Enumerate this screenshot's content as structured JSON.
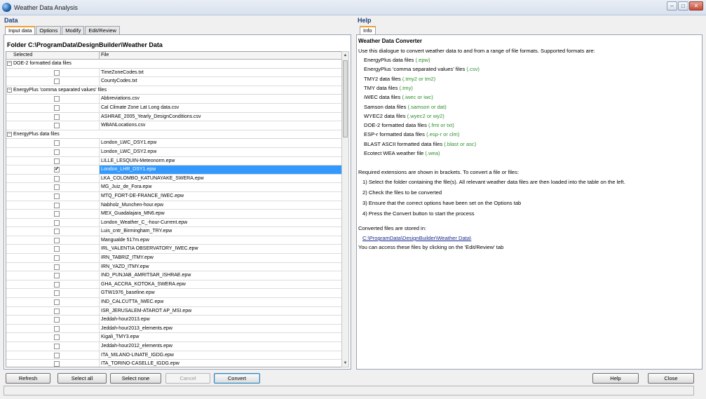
{
  "window": {
    "title": "Weather Data Analysis"
  },
  "data_panel": {
    "header": "Data",
    "tabs": [
      "Input data",
      "Options",
      "Modify",
      "Edit/Review"
    ],
    "folder_label": "Folder  C:\\ProgramData\\DesignBuilder\\Weather Data",
    "columns": {
      "selected": "Selected",
      "file": "File"
    },
    "groups": [
      {
        "name": "DOE-2 formatted data files",
        "rows": [
          {
            "file": "TimeZoneCodes.txt",
            "checked": false
          },
          {
            "file": "CountyCodes.txt",
            "checked": false
          }
        ]
      },
      {
        "name": "EnergyPlus 'comma separated values' files",
        "rows": [
          {
            "file": "Abbreviations.csv",
            "checked": false
          },
          {
            "file": "Cal Climate Zone Lat Long data.csv",
            "checked": false
          },
          {
            "file": "ASHRAE_2005_Yearly_DesignConditions.csv",
            "checked": false
          },
          {
            "file": "WBANLocations.csv",
            "checked": false
          }
        ]
      },
      {
        "name": "EnergyPlus data files",
        "rows": [
          {
            "file": "London_LWC_DSY1.epw",
            "checked": false
          },
          {
            "file": "London_LWC_DSY2.epw",
            "checked": false
          },
          {
            "file": "LILLE_LESQUIN-Meteonorm.epw",
            "checked": false
          },
          {
            "file": "London_LHR_DSY1.epw",
            "checked": true,
            "selected": true
          },
          {
            "file": "LKA_COLOMBO_KATUNAYAKE_SWERA.epw",
            "checked": false
          },
          {
            "file": "MG_Juiz_de_Fora.epw",
            "checked": false
          },
          {
            "file": "MTQ_FORT-DE-FRANCE_IWEC.epw",
            "checked": false
          },
          {
            "file": "Nabholz_Munchen-hour.epw",
            "checked": false
          },
          {
            "file": "MEX_Guadalajara_MN6.epw",
            "checked": false
          },
          {
            "file": "London_Weather_C_-hour-Current.epw",
            "checked": false
          },
          {
            "file": "Luis_cntr_Birmingham_TRY.epw",
            "checked": false
          },
          {
            "file": "Mangualde 517m.epw",
            "checked": false
          },
          {
            "file": "IRL_VALENTIA OBSERVATORY_IWEC.epw",
            "checked": false
          },
          {
            "file": "IRN_TABRIZ_ITMY.epw",
            "checked": false
          },
          {
            "file": "IRN_YAZD_ITMY.epw",
            "checked": false
          },
          {
            "file": "IND_PUNJAB_AMRITSAR_ISHRAE.epw",
            "checked": false
          },
          {
            "file": "GHA_ACCRA_KOTOKA_SWERA.epw",
            "checked": false
          },
          {
            "file": "GTW1976_baseline.epw",
            "checked": false
          },
          {
            "file": "IND_CALCUTTA_IWEC.epw",
            "checked": false
          },
          {
            "file": "ISR_JERUSALEM-ATAROT AP_MSI.epw",
            "checked": false
          },
          {
            "file": "Jeddah-hour2013.epw",
            "checked": false
          },
          {
            "file": "Jeddah-hour2013_elements.epw",
            "checked": false
          },
          {
            "file": "Kigali_TMY3.epw",
            "checked": false
          },
          {
            "file": "Jeddah-hour2012_elements.epw",
            "checked": false
          },
          {
            "file": "ITA_MILANO-LINATE_IGDG.epw",
            "checked": false
          },
          {
            "file": "ITA_TORINO-CASELLE_IGDG.epw",
            "checked": false
          }
        ]
      }
    ]
  },
  "help_panel": {
    "header": "Help",
    "tabs": [
      "Info"
    ],
    "title": "Weather Data Converter",
    "intro": "Use this dialogue to convert weather data to and from a range of file formats. Supported formats are:",
    "formats": [
      {
        "name": "EnergyPlus data files ",
        "ext": "(.epw)"
      },
      {
        "name": "EnergyPlus 'comma separated values' files ",
        "ext": "(.csv)"
      },
      {
        "name": "TMY2 data files ",
        "ext": "(.tmy2 or tm2)"
      },
      {
        "name": "TMY data files ",
        "ext": "(.tmy)"
      },
      {
        "name": "IWEC data files ",
        "ext": "(.iwec or iwc)"
      },
      {
        "name": "Samson data files ",
        "ext": "(.samson or dat)"
      },
      {
        "name": "WYEC2 data files ",
        "ext": "(.wyec2 or wy2)"
      },
      {
        "name": "DOE-2 formatted data files ",
        "ext": "(.fmt or txt)"
      },
      {
        "name": "ESP-r formatted data files ",
        "ext": "(.esp-r or clm)"
      },
      {
        "name": "BLAST ASCII formatted data files ",
        "ext": "(.blast or asc)"
      },
      {
        "name": "Ecotect WEA weather file ",
        "ext": "(.wea)"
      }
    ],
    "required_text": "Required extensions are shown in brackets.  To convert a file or files:",
    "steps": [
      "1)  Select the folder containing the file(s).  All relevant weather data files are then loaded into the table on the left.",
      "2)  Check the files to be converted",
      "3)  Ensure that the correct options have been set on the Options tab",
      "4)  Press the Convert button to start the process"
    ],
    "stored_text": "Converted files are stored in:",
    "stored_path": "C:\\ProgramData\\DesignBuilder\\Weather Data\\",
    "access_text": "You can access these files by clicking on the 'Edit/Review' tab"
  },
  "buttons": {
    "refresh": "Refresh",
    "select_all": "Select all",
    "select_none": "Select none",
    "cancel": "Cancel",
    "convert": "Convert",
    "help": "Help",
    "close": "Close"
  },
  "colors": {
    "selection": "#3399ff",
    "extension": "#2f8f2f",
    "header": "#1c3f7a",
    "tab_accent": "#f0a030"
  }
}
